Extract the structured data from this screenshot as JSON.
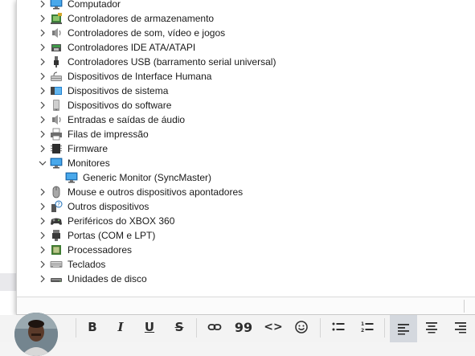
{
  "device_tree": [
    {
      "label": "Computador",
      "icon": "computer-icon",
      "expanded": false
    },
    {
      "label": "Controladores de armazenamento",
      "icon": "storage-controller-icon",
      "expanded": false
    },
    {
      "label": "Controladores de som, vídeo e jogos",
      "icon": "speaker-icon",
      "expanded": false
    },
    {
      "label": "Controladores IDE ATA/ATAPI",
      "icon": "ide-controller-icon",
      "expanded": false
    },
    {
      "label": "Controladores USB (barramento serial universal)",
      "icon": "usb-icon",
      "expanded": false
    },
    {
      "label": "Dispositivos de Interface Humana",
      "icon": "hid-icon",
      "expanded": false
    },
    {
      "label": "Dispositivos de sistema",
      "icon": "system-device-icon",
      "expanded": false
    },
    {
      "label": "Dispositivos do software",
      "icon": "software-device-icon",
      "expanded": false
    },
    {
      "label": "Entradas e saídas de áudio",
      "icon": "audio-io-icon",
      "expanded": false
    },
    {
      "label": "Filas de impressão",
      "icon": "printer-icon",
      "expanded": false
    },
    {
      "label": "Firmware",
      "icon": "firmware-icon",
      "expanded": false
    },
    {
      "label": "Monitores",
      "icon": "monitor-icon",
      "expanded": true
    },
    {
      "label": "Generic Monitor (SyncMaster)",
      "icon": "monitor-icon",
      "child": true
    },
    {
      "label": "Mouse e outros dispositivos apontadores",
      "icon": "mouse-icon",
      "expanded": false
    },
    {
      "label": "Outros dispositivos",
      "icon": "unknown-device-icon",
      "expanded": false
    },
    {
      "label": "Periféricos do XBOX 360",
      "icon": "gamepad-icon",
      "expanded": false
    },
    {
      "label": "Portas (COM e LPT)",
      "icon": "port-icon",
      "expanded": false
    },
    {
      "label": "Processadores",
      "icon": "processor-icon",
      "expanded": false
    },
    {
      "label": "Teclados",
      "icon": "keyboard-icon",
      "expanded": false
    },
    {
      "label": "Unidades de disco",
      "icon": "disk-drive-icon",
      "expanded": false
    }
  ],
  "toolbar": {
    "bold": "B",
    "italic": "I",
    "underline": "U",
    "strikethrough": "S",
    "quote": "99",
    "code": "<>",
    "buttons": [
      "bold-icon",
      "italic-icon",
      "underline-icon",
      "strikethrough-icon",
      "link-icon",
      "quote-icon",
      "code-icon",
      "emoji-icon",
      "bullet-list-icon",
      "numbered-list-icon",
      "align-left-icon",
      "align-center-icon",
      "align-right-icon"
    ]
  },
  "colors": {
    "window_bg": "#ffffff",
    "text": "#1a1a1a",
    "monitor_blue": "#2b8fd6",
    "toolbar_bg": "#f3f3f3",
    "toolbar_active": "#d4d8de"
  }
}
